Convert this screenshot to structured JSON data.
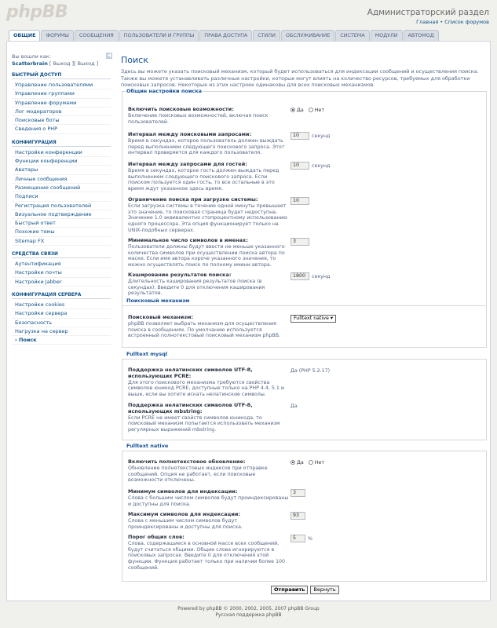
{
  "header": {
    "logo": "phpBB",
    "title": "Администраторский раздел",
    "link_main": "Главная",
    "link_sep": " • ",
    "link_forums": "Список форумов"
  },
  "tabs": [
    "Общие",
    "Форумы",
    "Сообщения",
    "Пользователи и группы",
    "Права доступа",
    "Стили",
    "Обслуживание",
    "Система",
    "Модули",
    "Автомод"
  ],
  "menu": {
    "logged_in": "Вы вошли как:",
    "username": "Scatterbrain",
    "logout": " [ Выход ]",
    "view": "[ Выход ]",
    "groups": [
      {
        "title": "Быстрый доступ",
        "items": [
          "Управление пользователями",
          "Управление группами",
          "Управление форумами",
          "Лог модераторов",
          "Поисковые боты",
          "Сведения о PHP"
        ]
      },
      {
        "title": "Конфигурация",
        "items": [
          "Настройки конференции",
          "Функции конференции",
          "Аватары",
          "Личные сообщения",
          "Размещение сообщений",
          "Подписи",
          "Регистрация пользователей",
          "Визуальное подтверждение",
          "Быстрый ответ",
          "Похожие темы",
          "Sitemap FX"
        ]
      },
      {
        "title": "Средства связи",
        "items": [
          "Аутентификация",
          "Настройки почты",
          "Настройки Jabber"
        ]
      },
      {
        "title": "Конфигурация сервера",
        "items": [
          "Настройки cookies",
          "Настройки сервера",
          "Безопасность",
          "Нагрузка на сервер",
          "Поиск"
        ]
      }
    ]
  },
  "main": {
    "title": "Поиск",
    "description": "Здесь вы можете указать поисковый механизм, который будет использоваться для индексации сообщений и осуществления поиска. Также вы можете устанавливать различные настройки, которые могут влиять на количество ресурсов, требуемых для обработки поисковых запросов. Некоторые из этих настроек одинаковы для всех поисковых механизмов."
  },
  "general": {
    "legend": "Общие настройки поиска",
    "enable": {
      "label": "Включить поисковые возможности:",
      "explain": "Включение поисковых возможностей, включая поиск пользователей.",
      "yes": "Да",
      "no": "Нет",
      "selected": "yes"
    },
    "interval": {
      "label": "Интервал между поисковыми запросами:",
      "explain": "Время в секундах, которое пользователь должен выждать перед выполнением следующего поискового запроса. Этот интервал проверяется для каждого пользователя.",
      "value": "10",
      "unit": "секунд"
    },
    "guest_interval": {
      "label": "Интервал между запросами для гостей:",
      "explain": "Время в секундах, которое гость должен выждать перед выполнением следующего поискового запроса. Если поиском пользуется один гость, то все остальные в это время ждут указанное здесь время.",
      "value": "10",
      "unit": "секунд"
    },
    "load": {
      "label": "Ограничение поиска при загрузке системы:",
      "explain": "Если загрузка системы в течение одной минуты превышает это значение, то поисковая страница будет недоступна. Значение 1.0 эквивалентно стопроцентному использованию одного процессора. Эта опция функционирует только на UNIX-подобных серверах.",
      "value": "10"
    },
    "min_author": {
      "label": "Минимальное число символов в именах:",
      "explain": "Пользователи должны будут ввести не меньше указанного количества символов при осуществлении поиска автора по маске. Если имя автора короче указанного значения, то можно осуществлять поиск по полному имени автора.",
      "value": "3"
    },
    "cache": {
      "label": "Кэширование результатов поиска:",
      "explain": "Длительность кэширования результатов поиска (в секундах). Введите 0 для отключения кэширования результатов.",
      "value": "1800",
      "unit": "секунд"
    }
  },
  "mechanism": {
    "legend": "Поисковый механизм",
    "label": "Поисковый механизм:",
    "explain": "phpBB позволяет выбрать механизм для осуществления поиска в сообщениях. По умолчанию используется встроенный полнотекстовый поисковый механизм phpBB.",
    "value": "Fulltext native"
  },
  "mysql": {
    "legend": "Fulltext mysql",
    "pcre": {
      "label": "Поддержка нелатинских символов UTF-8, использующих PCRE:",
      "explain": "Для этого поискового механизма требуются свойства символов юникод PCRE, доступные только на PHP 4.4, 5.1 и выше, если вы хотите искать нелатинские символы.",
      "value": "Да (PHP 5.2.17)"
    },
    "mbstring": {
      "label": "Поддержка нелатинских символов UTF-8, использующих mbstring:",
      "explain": "Если PCRE не имеет свойств символов юникода, то поисковый механизм попытается использовать механизм регулярных выражений mbstring.",
      "value": "Да"
    }
  },
  "native": {
    "legend": "Fulltext native",
    "update": {
      "label": "Включить полнотекстовое обновление:",
      "explain": "Обновление полнотекстовых индексов при отправке сообщений. Опция не работает, если поисковые возможности отключены.",
      "yes": "Да",
      "no": "Нет",
      "selected": "yes"
    },
    "min_chars": {
      "label": "Минимум символов для индексации:",
      "explain": "Слова с большим числом символов будут проиндексированы и доступны для поиска.",
      "value": "3"
    },
    "max_chars": {
      "label": "Максимум символов для индексации:",
      "explain": "Слова с меньшим числом символов будут проиндексированы и доступны для поиска.",
      "value": "93"
    },
    "common": {
      "label": "Порог общих слов:",
      "explain": "Слова, содержащиеся в основной массе всех сообщений, будут считаться общими. Общие слова игнорируются в поисковых запросах. Введите 0 для отключения этой функции. Функция работает только при наличии более 100 сообщений.",
      "value": "5",
      "unit": "%"
    }
  },
  "buttons": {
    "submit": "Отправить",
    "reset": "Вернуть"
  },
  "footer": {
    "line1": "Powered by phpBB © 2000, 2002, 2005, 2007 phpBB Group",
    "line2": "Русская поддержка phpBB"
  }
}
